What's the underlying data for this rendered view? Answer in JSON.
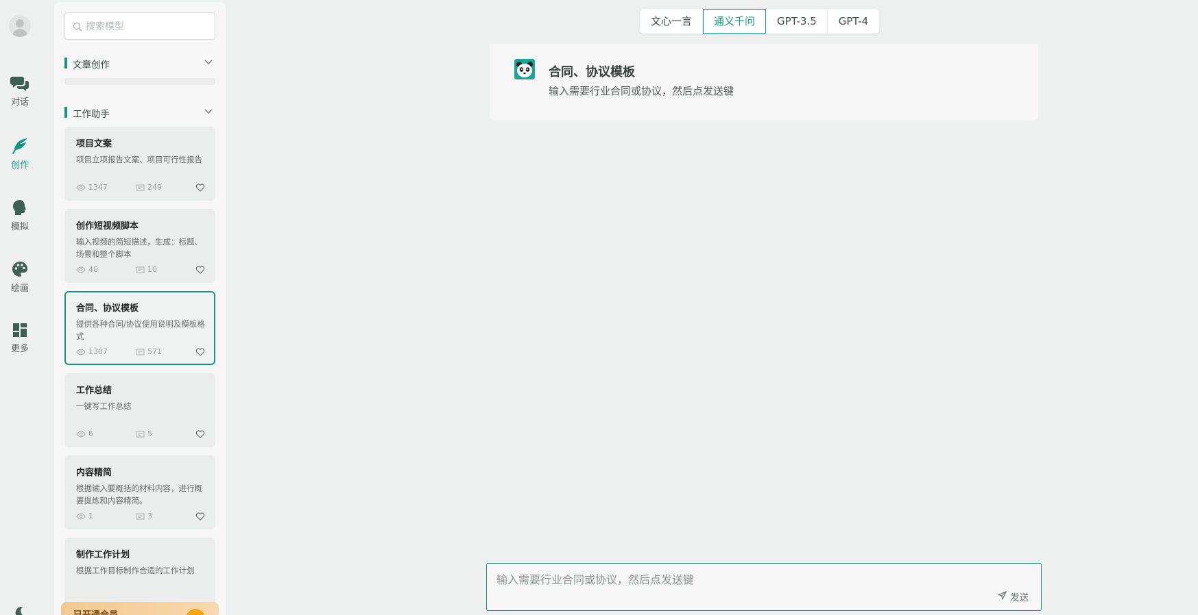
{
  "rail": {
    "items": [
      {
        "label": "对话",
        "icon": "chat-bubbles-icon"
      },
      {
        "label": "创作",
        "icon": "feather-icon",
        "active": true
      },
      {
        "label": "模拟",
        "icon": "head-profile-icon"
      },
      {
        "label": "绘画",
        "icon": "palette-icon"
      },
      {
        "label": "更多",
        "icon": "dashboard-grid-icon"
      }
    ]
  },
  "sidebar": {
    "search_placeholder": "搜索模型",
    "sections": [
      {
        "title": "文章创作",
        "collapsed": true
      },
      {
        "title": "工作助手",
        "collapsed": false
      }
    ],
    "cards": [
      {
        "title": "项目文案",
        "desc": "项目立项报告文案、项目可行性报告",
        "views": "1347",
        "comments": "249"
      },
      {
        "title": "创作短视频脚本",
        "desc": "输入视频的简短描述，生成：标题、场景和整个脚本",
        "views": "40",
        "comments": "10"
      },
      {
        "title": "合同、协议模板",
        "desc": "提供各种合同/协议使用说明及模板格式",
        "views": "1307",
        "comments": "571",
        "active": true
      },
      {
        "title": "工作总结",
        "desc": "一键写工作总结",
        "views": "6",
        "comments": "5"
      },
      {
        "title": "内容精简",
        "desc": "根据输入要概括的材料内容，进行概要提炼和内容精简。",
        "views": "1",
        "comments": "3"
      },
      {
        "title": "制作工作计划",
        "desc": "根据工作目标制作合适的工作计划",
        "views": "",
        "comments": ""
      }
    ],
    "vip_label": "已开通会员"
  },
  "model_tabs": [
    "文心一言",
    "通义千问",
    "GPT-3.5",
    "GPT-4"
  ],
  "active_model": "通义千问",
  "intro": {
    "title": "合同、协议模板",
    "desc": "输入需要行业合同或协议，然后点发送键"
  },
  "composer": {
    "placeholder": "输入需要行业合同或协议，然后点发送键",
    "send_label": "发送"
  },
  "colors": {
    "accent": "#16977d",
    "background": "#eef0ef"
  }
}
